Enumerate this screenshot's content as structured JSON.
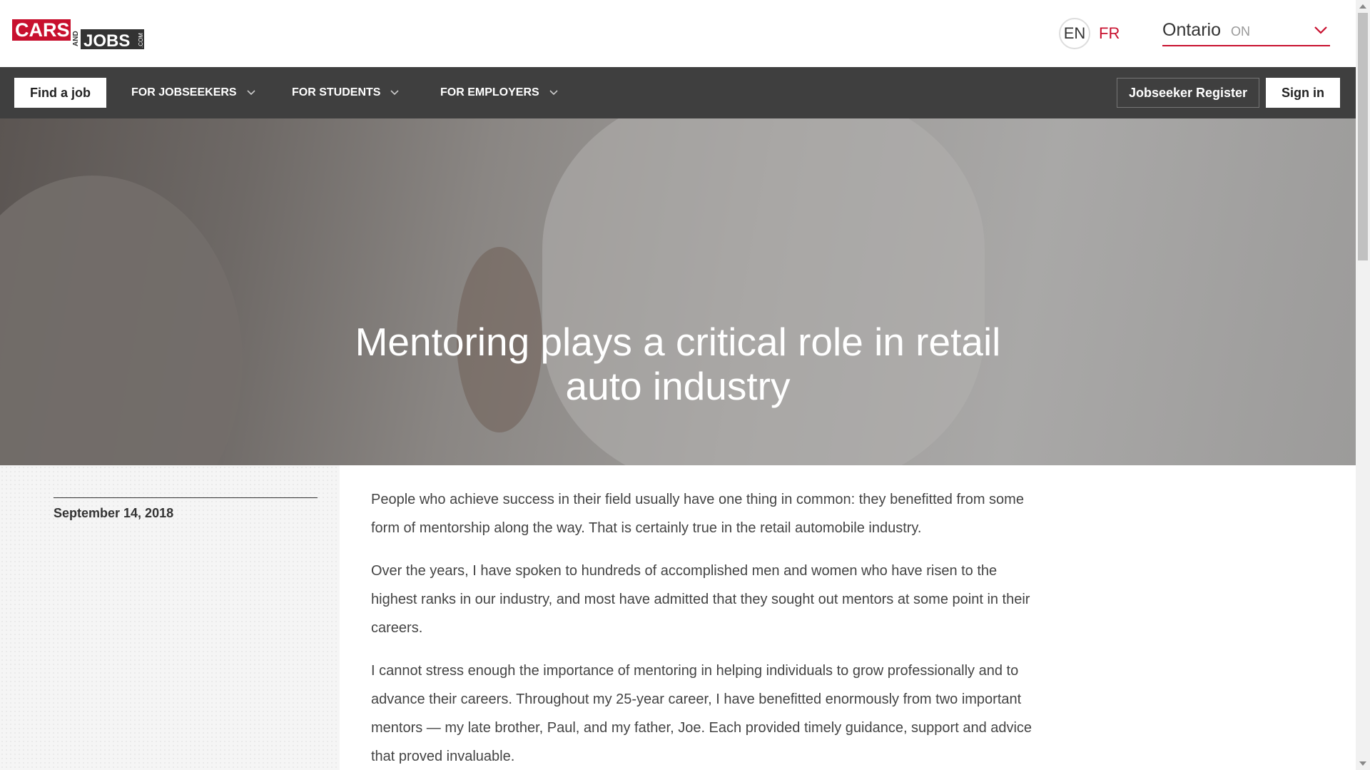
{
  "header": {
    "logo": {
      "line1": "CARS",
      "and": "AND",
      "line2": "JOBS",
      "suffix": ".COM"
    },
    "lang_en": "EN",
    "lang_fr": "FR",
    "region_name": "Ontario",
    "region_code": "ON"
  },
  "nav": {
    "find_job": "Find a job",
    "items": [
      {
        "label": "FOR JOBSEEKERS"
      },
      {
        "label": "FOR STUDENTS"
      },
      {
        "label": "FOR EMPLOYERS"
      }
    ],
    "register": "Jobseeker Register",
    "signin": "Sign in"
  },
  "hero": {
    "title": "Mentoring plays a critical role in retail auto industry"
  },
  "article": {
    "date": "September 14, 2018",
    "paragraphs": [
      "People who achieve success in their field usually have one thing in common: they benefitted from some form of mentorship along the way. That is certainly true in the retail automobile industry.",
      "Over the years, I have spoken to hundreds of accomplished men and women who have risen to the highest ranks in our industry, and most have admitted that they sought out mentors at some point in their careers.",
      "I cannot stress enough the importance of mentoring in helping individuals to grow professionally and to advance their careers. Throughout my 25-year career, I have benefitted enormously from two important mentors — my late brother, Paul, and my father, Joe. Each provided timely guidance, support and advice that proved invaluable."
    ]
  },
  "colors": {
    "brand_red": "#c8102e",
    "nav_bg": "#3f3f3f"
  }
}
